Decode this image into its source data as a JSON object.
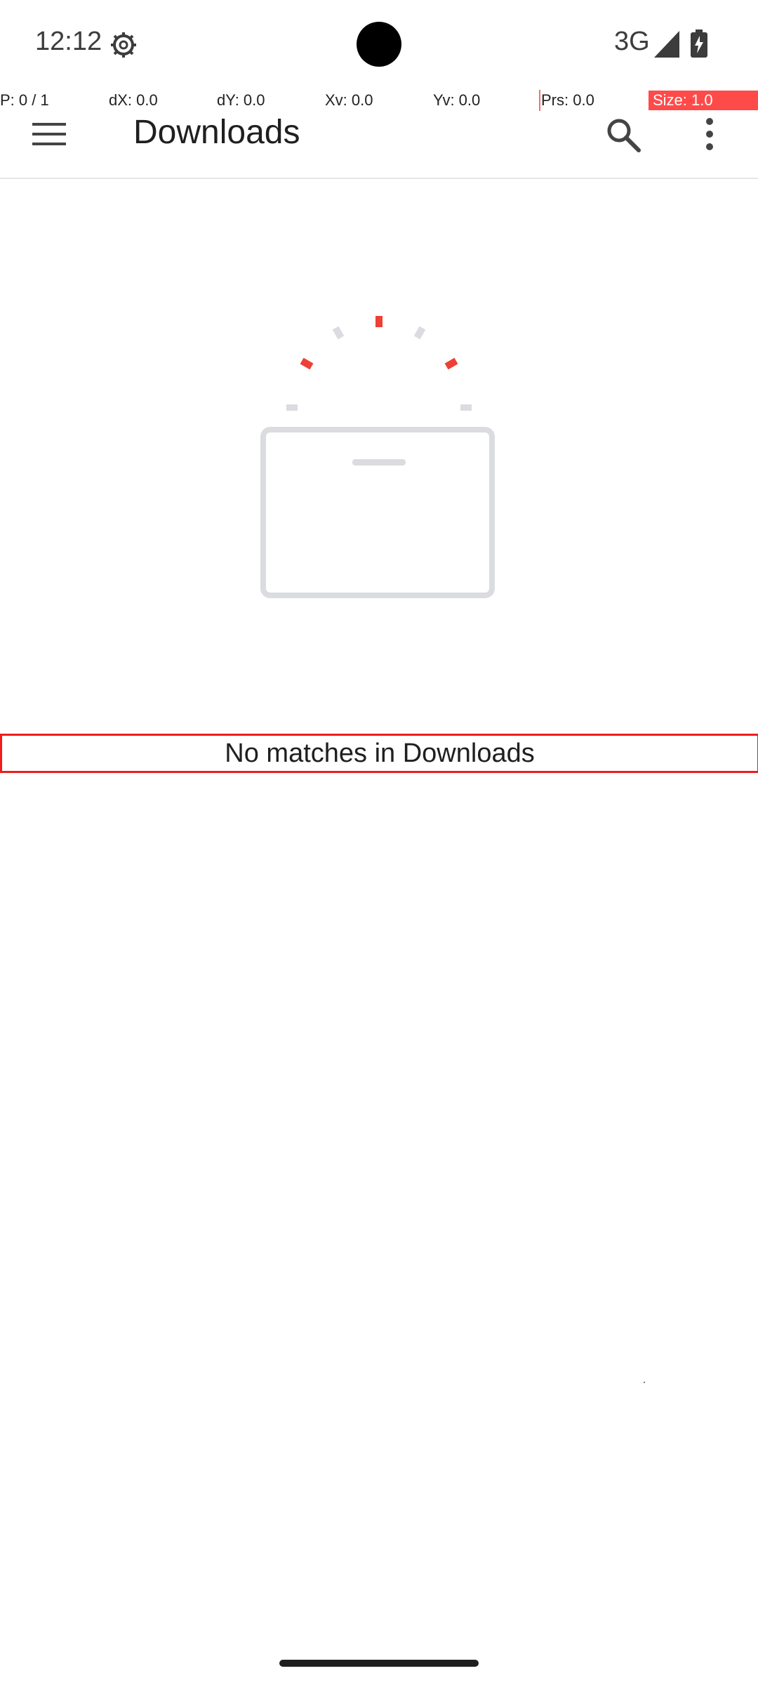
{
  "status_bar": {
    "time": "12:12",
    "network": "3G"
  },
  "pointer_overlay": {
    "p": "P: 0 / 1",
    "dx": "dX: 0.0",
    "dy": "dY: 0.0",
    "xv": "Xv: 0.0",
    "yv": "Yv: 0.0",
    "prs": "Prs: 0.0",
    "size": "Size: 1.0"
  },
  "app_bar": {
    "title": "Downloads"
  },
  "empty_state": {
    "message": "No matches in Downloads"
  },
  "colors": {
    "accent_red": "#ee4035",
    "illustration_gray": "#dadce0",
    "highlight_border": "#ee1c1c"
  },
  "icons": {
    "status": [
      "gear-icon",
      "signal-icon",
      "battery-icon"
    ],
    "app_bar": [
      "menu-icon",
      "search-icon",
      "overflow-menu-icon"
    ]
  }
}
